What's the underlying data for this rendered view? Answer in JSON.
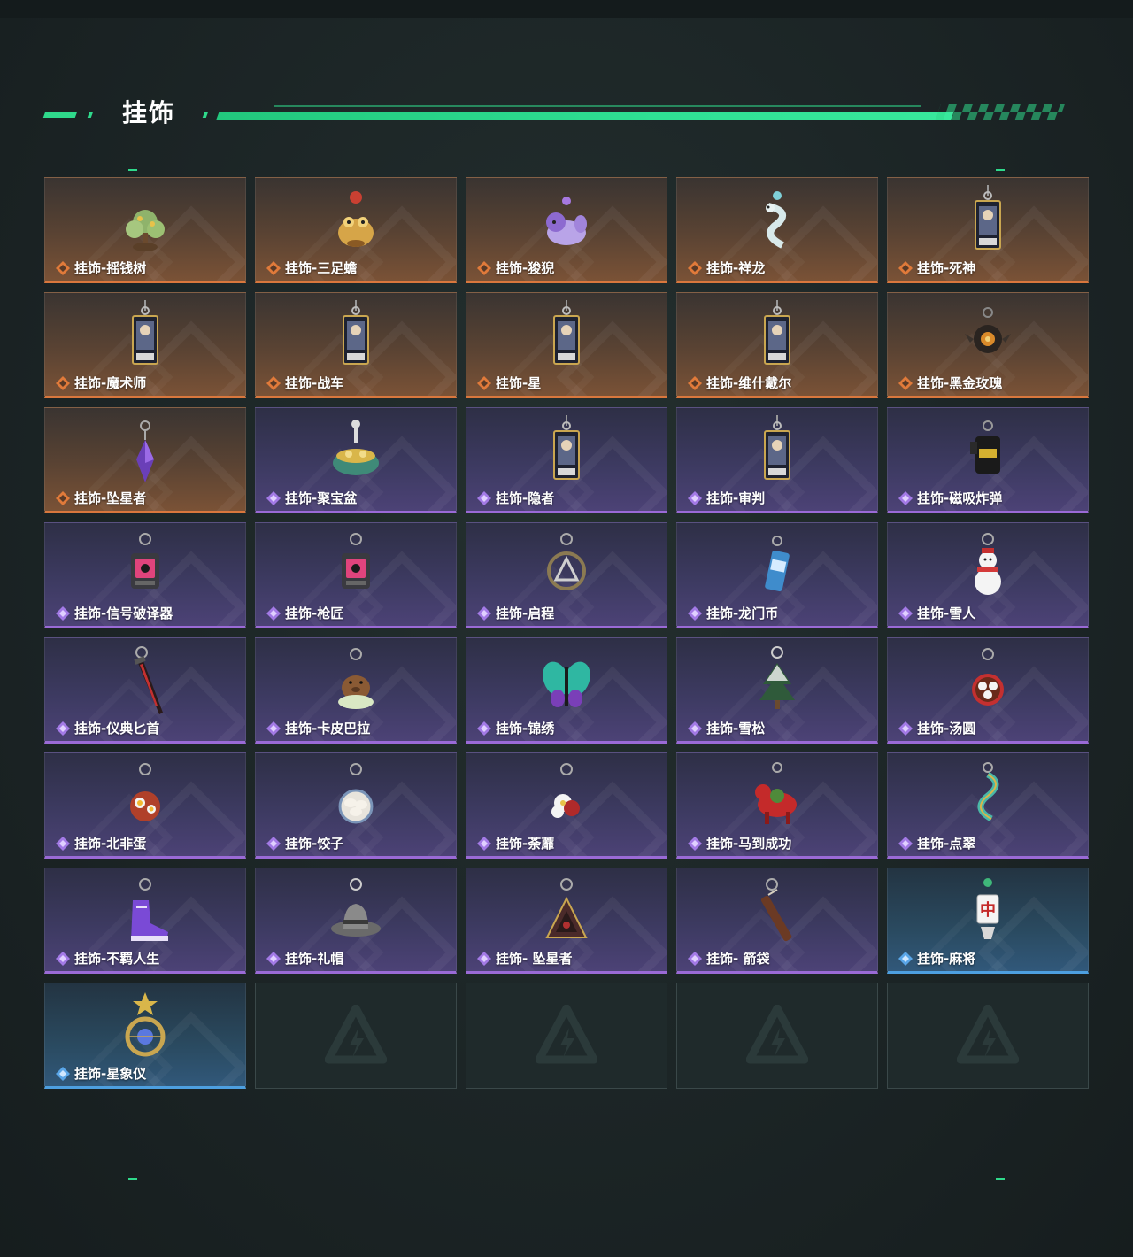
{
  "page": {
    "title": "挂饰"
  },
  "colors": {
    "accent": "#2fd98b",
    "orange": "#d9773d",
    "purple": "#9a6ad6",
    "blue": "#4d9fe0"
  },
  "items": [
    {
      "label": "挂饰-摇钱树",
      "rarity": "orange",
      "icon": "money-tree-charm",
      "art": "tree"
    },
    {
      "label": "挂饰-三足蟾",
      "rarity": "orange",
      "icon": "golden-toad-charm",
      "art": "toad"
    },
    {
      "label": "挂饰-狻猊",
      "rarity": "orange",
      "icon": "suanni-lion-charm",
      "art": "lion"
    },
    {
      "label": "挂饰-祥龙",
      "rarity": "orange",
      "icon": "dragon-charm",
      "art": "dragon"
    },
    {
      "label": "挂饰-死神",
      "rarity": "orange",
      "icon": "death-card-charm",
      "art": "card"
    },
    {
      "label": "挂饰-魔术师",
      "rarity": "orange",
      "icon": "magician-card-charm",
      "art": "card"
    },
    {
      "label": "挂饰-战车",
      "rarity": "orange",
      "icon": "chariot-card-charm",
      "art": "card"
    },
    {
      "label": "挂饰-星",
      "rarity": "orange",
      "icon": "star-card-charm",
      "art": "card"
    },
    {
      "label": "挂饰-维什戴尔",
      "rarity": "orange",
      "icon": "wisdel-card-charm",
      "art": "card"
    },
    {
      "label": "挂饰-黑金玫瑰",
      "rarity": "orange",
      "icon": "black-gold-rose-charm",
      "art": "rose"
    },
    {
      "label": "挂饰-坠星者",
      "rarity": "orange",
      "icon": "falling-star-crystal-charm",
      "art": "crystal"
    },
    {
      "label": "挂饰-聚宝盆",
      "rarity": "purple",
      "icon": "treasure-bowl-charm",
      "art": "bowl"
    },
    {
      "label": "挂饰-隐者",
      "rarity": "purple",
      "icon": "hermit-card-charm",
      "art": "card"
    },
    {
      "label": "挂饰-审判",
      "rarity": "purple",
      "icon": "judgement-card-charm",
      "art": "card"
    },
    {
      "label": "挂饰-磁吸炸弹",
      "rarity": "purple",
      "icon": "magnetic-bomb-charm",
      "art": "bomb"
    },
    {
      "label": "挂饰-信号破译器",
      "rarity": "purple",
      "icon": "signal-decoder-charm",
      "art": "device"
    },
    {
      "label": "挂饰-枪匠",
      "rarity": "purple",
      "icon": "gunsmith-charm",
      "art": "device"
    },
    {
      "label": "挂饰-启程",
      "rarity": "purple",
      "icon": "departure-medal-charm",
      "art": "medal"
    },
    {
      "label": "挂饰-龙门币",
      "rarity": "purple",
      "icon": "lungmen-coin-charm",
      "art": "can"
    },
    {
      "label": "挂饰-雪人",
      "rarity": "purple",
      "icon": "snowman-charm",
      "art": "snowman"
    },
    {
      "label": "挂饰-仪典匕首",
      "rarity": "purple",
      "icon": "ritual-dagger-charm",
      "art": "dagger"
    },
    {
      "label": "挂饰-卡皮巴拉",
      "rarity": "purple",
      "icon": "capybara-charm",
      "art": "capybara"
    },
    {
      "label": "挂饰-锦绣",
      "rarity": "purple",
      "icon": "butterfly-charm",
      "art": "butterfly"
    },
    {
      "label": "挂饰-雪松",
      "rarity": "purple",
      "icon": "snow-pine-charm",
      "art": "pine"
    },
    {
      "label": "挂饰-汤圆",
      "rarity": "purple",
      "icon": "tangyuan-charm",
      "art": "tangyuan"
    },
    {
      "label": "挂饰-北非蛋",
      "rarity": "purple",
      "icon": "shakshuka-charm",
      "art": "shakshuka"
    },
    {
      "label": "挂饰-饺子",
      "rarity": "purple",
      "icon": "dumplings-charm",
      "art": "dumplings"
    },
    {
      "label": "挂饰-荼蘼",
      "rarity": "purple",
      "icon": "rose-flower-charm",
      "art": "flower"
    },
    {
      "label": "挂饰-马到成功",
      "rarity": "purple",
      "icon": "red-horse-charm",
      "art": "horse"
    },
    {
      "label": "挂饰-点翠",
      "rarity": "purple",
      "icon": "kingfisher-dragon-charm",
      "art": "serpent"
    },
    {
      "label": "挂饰-不羁人生",
      "rarity": "purple",
      "icon": "sneaker-charm",
      "art": "shoe"
    },
    {
      "label": "挂饰-礼帽",
      "rarity": "purple",
      "icon": "fedora-hat-charm",
      "art": "hat"
    },
    {
      "label": "挂饰- 坠星者",
      "rarity": "purple",
      "icon": "triangle-pendant-charm",
      "art": "triangle"
    },
    {
      "label": "挂饰- 箭袋",
      "rarity": "purple",
      "icon": "quiver-charm",
      "art": "quiver"
    },
    {
      "label": "挂饰-麻将",
      "rarity": "blue",
      "icon": "mahjong-tile-charm",
      "art": "mahjong"
    },
    {
      "label": "挂饰-星象仪",
      "rarity": "blue",
      "icon": "astrolabe-charm",
      "art": "astrolabe"
    }
  ],
  "empty_slots": 4
}
